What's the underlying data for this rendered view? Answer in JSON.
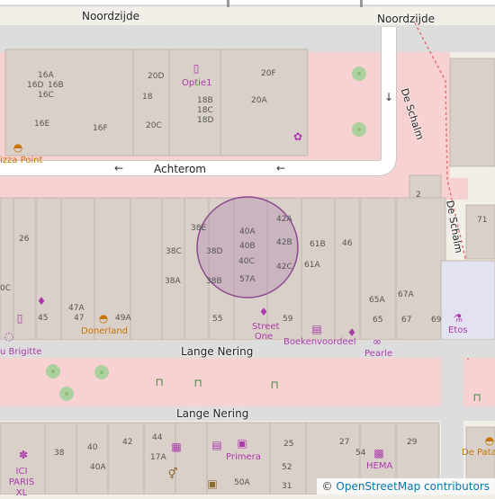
{
  "map": {
    "colors": {
      "background": "#f2efe9",
      "pedestrian": "#f8d2d2",
      "building": "#d9d0c9",
      "building_stroke": "#c4b6ab",
      "road": "#ffffff",
      "road_casing": "#c8c8c8",
      "tree": "#add19e",
      "tree_center": "#8cbf7a",
      "circle_fill": "#b080b0",
      "circle_stroke": "#8e4a8e"
    },
    "streets": {
      "noordzijde_left": "Noordzijde",
      "noordzijde_right": "Noordzijde",
      "achterom": "Achterom",
      "de_schalm_top": "De Schalm",
      "de_schalm_mid": "De Schalm",
      "lange_nering_top": "Lange Nering",
      "lange_nering_bottom": "Lange Nering"
    },
    "house_numbers": {
      "n16a": "16A",
      "n16d": "16D",
      "n16b": "16B",
      "n16c": "16C",
      "n16e": "16E",
      "n16f": "16F",
      "n20d": "20D",
      "n18": "18",
      "n20c": "20C",
      "n18b": "18B",
      "n18c": "18C",
      "n18d": "18D",
      "n20f": "20F",
      "n20a": "20A",
      "n2": "2",
      "n71": "71",
      "n26": "26",
      "n38e": "38E",
      "n38c": "38C",
      "n38d": "38D",
      "n38a": "38A",
      "n38b": "38B",
      "n40a": "40A",
      "n40b": "40B",
      "n40c": "40C",
      "n57a": "57A",
      "n42a": "42A",
      "n42b": "42B",
      "n42c": "42C",
      "n61b": "61B",
      "n61a": "61A",
      "n46": "46",
      "n65a": "65A",
      "n67a": "67A",
      "n0c": "0C",
      "n45": "45",
      "n47a": "47A",
      "n47": "47",
      "n49a": "49A",
      "n55": "55",
      "n59": "59",
      "n65": "65",
      "n67": "67",
      "n69": "69",
      "n38_bottom": "38",
      "n40_bottom": "40",
      "n42_bottom": "42",
      "n44_bottom": "44",
      "n40a_bottom": "40A",
      "n17a": "17A",
      "n25": "25",
      "n27": "27",
      "n29": "29",
      "n54": "54",
      "n52": "52",
      "n50a": "50A",
      "n31": "31"
    },
    "pois": {
      "optiel": "Optie1",
      "pizza_point": "izza Point",
      "donerland": "Donerland",
      "street_one": "Street One",
      "boekenvoordeel": "Boekenvoordeel",
      "pearle": "Pearle",
      "etos": "Etos",
      "brigitte": "u Brigitte",
      "ici_paris": "ICI PARIS XL",
      "primera": "Primera",
      "hema": "HEMA",
      "de_pata": "De Pata"
    },
    "icons": {
      "phone": "mobile-phone-icon",
      "burger": "fast-food-icon",
      "flower": "florist-icon",
      "clothes": "clothes-shop-icon",
      "book": "bookshop-icon",
      "glasses": "optician-icon",
      "chemist": "chemist-icon",
      "jewelry": "jewelry-icon",
      "perfume": "perfumery-icon",
      "bench": "bench-icon",
      "toilets": "toilets-icon",
      "newsagent": "newsagent-icon",
      "gift": "gift-shop-icon",
      "bag": "department-store-icon"
    },
    "oneway_arrow": "←",
    "oneway_arrow_down": "↓"
  },
  "attribution": {
    "symbol": "©",
    "link_text": "OpenStreetMap contributors"
  }
}
